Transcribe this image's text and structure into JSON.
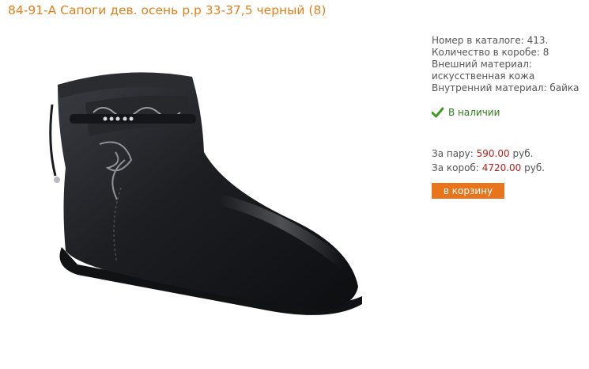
{
  "product": {
    "title": "84-91-А Сапоги дев. осень р.р 33-37,5 черный (8)"
  },
  "details": {
    "catalog_number": "Номер в каталоге: 413.",
    "box_quantity": "Количество в коробе: 8",
    "outer_material_label": "Внешний материал:",
    "outer_material_value": "искусственная кожа",
    "inner_material": "Внутренний материал: байка"
  },
  "availability": {
    "icon": "checkmark-icon",
    "text": "В наличии"
  },
  "pricing": {
    "pair_label": "За пару:",
    "pair_price": "590.00",
    "pair_currency": "руб.",
    "box_label": "За короб:",
    "box_price": "4720.00",
    "box_currency": "руб."
  },
  "actions": {
    "cart_button_label": "в корзину"
  },
  "colors": {
    "title": "#e07f1a",
    "price": "#b3211f",
    "stock": "#2f7d1a",
    "button": "#e8741c"
  }
}
